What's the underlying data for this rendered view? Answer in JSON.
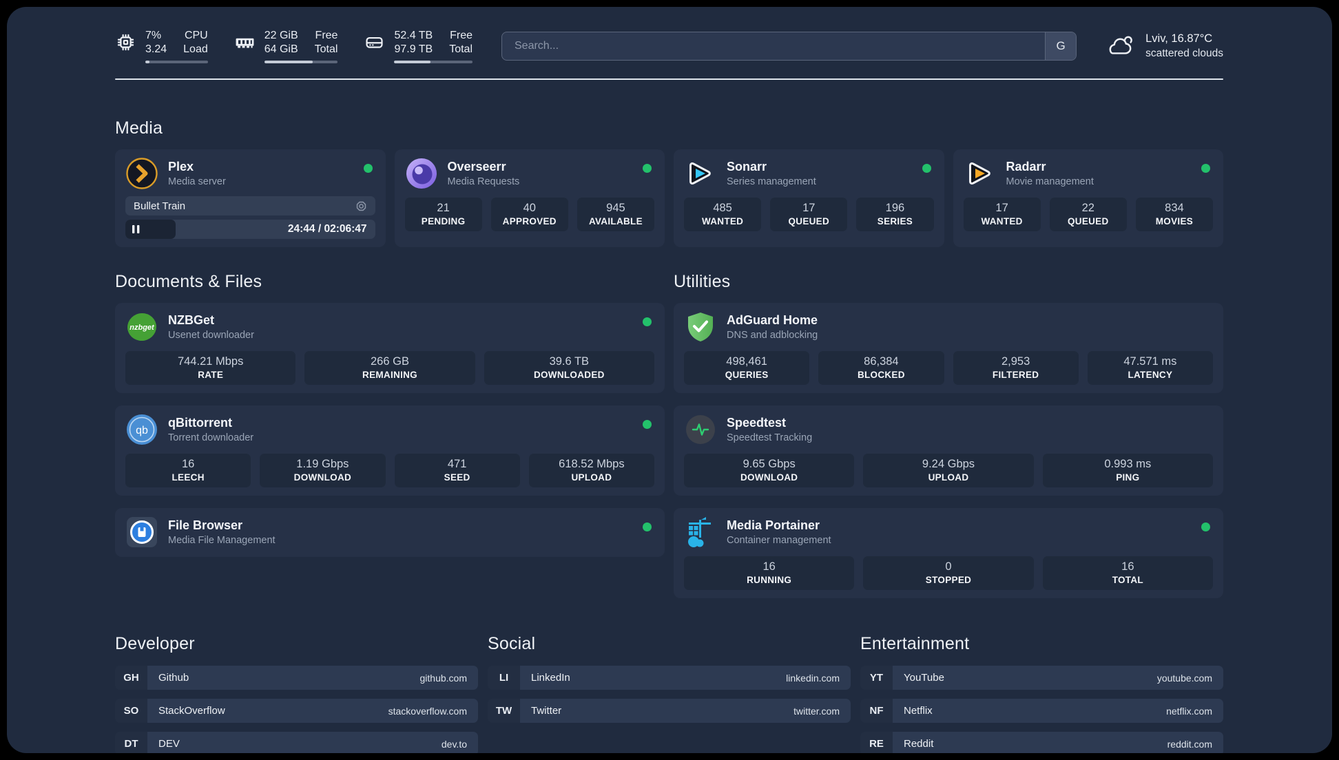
{
  "colors": {
    "page_bg": "#202b3f",
    "card_bg": "#263147",
    "stat_box_bg": "#1f2a3c",
    "status_online": "#23c16b",
    "plex_accent": "#e8a22c",
    "sonarr_accent": "#35c5f4",
    "radarr_accent": "#f7a825",
    "overseerr_accent": "#8b6ce4",
    "nzbget_accent": "#45a135",
    "qbittorrent_accent": "#4a8fd4",
    "filebrowser_accent": "#2d7fe0",
    "adguard_accent": "#5cb85c",
    "speedtest_accent": "#2ecc71",
    "portainer_accent": "#29b3e8"
  },
  "header": {
    "stats": [
      {
        "icon": "cpu-icon",
        "values": [
          "7%",
          "3.24"
        ],
        "labels": [
          "CPU",
          "Load"
        ],
        "progress": 7
      },
      {
        "icon": "memory-icon",
        "values": [
          "22 GiB",
          "64 GiB"
        ],
        "labels": [
          "Free",
          "Total"
        ],
        "progress": 66
      },
      {
        "icon": "disk-icon",
        "values": [
          "52.4 TB",
          "97.9 TB"
        ],
        "labels": [
          "Free",
          "Total"
        ],
        "progress": 46
      }
    ],
    "search": {
      "placeholder": "Search...",
      "button_label": "G"
    },
    "weather": {
      "icon": "cloud-icon",
      "location": "Lviv, 16.87°C",
      "condition": "scattered clouds"
    }
  },
  "media": {
    "heading": "Media",
    "plex": {
      "icon": "plex-icon",
      "title": "Plex",
      "subtitle": "Media server",
      "online": true,
      "now_playing": "Bullet Train",
      "time": "24:44 / 02:06:47",
      "progress": 20
    },
    "cards": [
      {
        "icon": "overseerr-icon",
        "title": "Overseerr",
        "subtitle": "Media Requests",
        "online": true,
        "stats": [
          {
            "value": "21",
            "label": "PENDING"
          },
          {
            "value": "40",
            "label": "APPROVED"
          },
          {
            "value": "945",
            "label": "AVAILABLE"
          }
        ]
      },
      {
        "icon": "sonarr-icon",
        "title": "Sonarr",
        "subtitle": "Series management",
        "online": true,
        "stats": [
          {
            "value": "485",
            "label": "WANTED"
          },
          {
            "value": "17",
            "label": "QUEUED"
          },
          {
            "value": "196",
            "label": "SERIES"
          }
        ]
      },
      {
        "icon": "radarr-icon",
        "title": "Radarr",
        "subtitle": "Movie management",
        "online": true,
        "stats": [
          {
            "value": "17",
            "label": "WANTED"
          },
          {
            "value": "22",
            "label": "QUEUED"
          },
          {
            "value": "834",
            "label": "MOVIES"
          }
        ]
      }
    ]
  },
  "documents": {
    "heading": "Documents & Files",
    "cards": [
      {
        "icon": "nzbget-icon",
        "title": "NZBGet",
        "subtitle": "Usenet downloader",
        "online": true,
        "stats": [
          {
            "value": "744.21 Mbps",
            "label": "RATE"
          },
          {
            "value": "266 GB",
            "label": "REMAINING"
          },
          {
            "value": "39.6 TB",
            "label": "DOWNLOADED"
          }
        ]
      },
      {
        "icon": "qbittorrent-icon",
        "title": "qBittorrent",
        "subtitle": "Torrent downloader",
        "online": true,
        "stats": [
          {
            "value": "16",
            "label": "LEECH"
          },
          {
            "value": "1.19 Gbps",
            "label": "DOWNLOAD"
          },
          {
            "value": "471",
            "label": "SEED"
          },
          {
            "value": "618.52 Mbps",
            "label": "UPLOAD"
          }
        ]
      },
      {
        "icon": "filebrowser-icon",
        "title": "File Browser",
        "subtitle": "Media File Management",
        "online": true,
        "stats": []
      }
    ]
  },
  "utilities": {
    "heading": "Utilities",
    "cards": [
      {
        "icon": "adguard-icon",
        "title": "AdGuard Home",
        "subtitle": "DNS and adblocking",
        "online": false,
        "stats": [
          {
            "value": "498,461",
            "label": "QUERIES"
          },
          {
            "value": "86,384",
            "label": "BLOCKED"
          },
          {
            "value": "2,953",
            "label": "FILTERED"
          },
          {
            "value": "47.571 ms",
            "label": "LATENCY"
          }
        ]
      },
      {
        "icon": "speedtest-icon",
        "title": "Speedtest",
        "subtitle": "Speedtest Tracking",
        "online": false,
        "stats": [
          {
            "value": "9.65 Gbps",
            "label": "DOWNLOAD"
          },
          {
            "value": "9.24 Gbps",
            "label": "UPLOAD"
          },
          {
            "value": "0.993 ms",
            "label": "PING"
          }
        ]
      },
      {
        "icon": "portainer-icon",
        "title": "Media Portainer",
        "subtitle": "Container management",
        "online": true,
        "stats": [
          {
            "value": "16",
            "label": "RUNNING"
          },
          {
            "value": "0",
            "label": "STOPPED"
          },
          {
            "value": "16",
            "label": "TOTAL"
          }
        ]
      }
    ]
  },
  "links": {
    "groups": [
      {
        "heading": "Developer",
        "items": [
          {
            "abbr": "GH",
            "name": "Github",
            "url": "github.com"
          },
          {
            "abbr": "SO",
            "name": "StackOverflow",
            "url": "stackoverflow.com"
          },
          {
            "abbr": "DT",
            "name": "DEV",
            "url": "dev.to"
          }
        ]
      },
      {
        "heading": "Social",
        "items": [
          {
            "abbr": "LI",
            "name": "LinkedIn",
            "url": "linkedin.com"
          },
          {
            "abbr": "TW",
            "name": "Twitter",
            "url": "twitter.com"
          }
        ]
      },
      {
        "heading": "Entertainment",
        "items": [
          {
            "abbr": "YT",
            "name": "YouTube",
            "url": "youtube.com"
          },
          {
            "abbr": "NF",
            "name": "Netflix",
            "url": "netflix.com"
          },
          {
            "abbr": "RE",
            "name": "Reddit",
            "url": "reddit.com"
          }
        ]
      }
    ]
  }
}
